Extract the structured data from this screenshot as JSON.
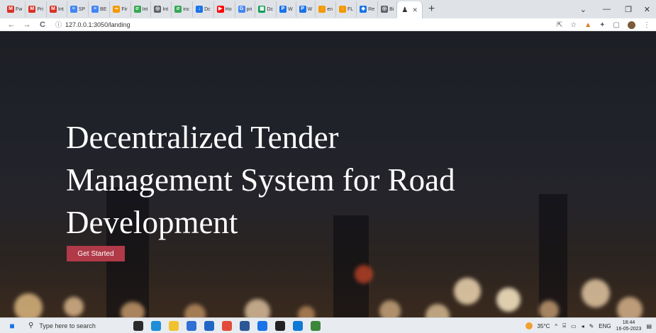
{
  "browser": {
    "tabs": [
      {
        "label": "Fw",
        "icon": "gmail-icon",
        "color": "#d93025"
      },
      {
        "label": "Pri",
        "icon": "gmail-icon",
        "color": "#d93025"
      },
      {
        "label": "Int",
        "icon": "gmail-icon",
        "color": "#d93025"
      },
      {
        "label": "SP",
        "icon": "doc-icon",
        "color": "#4285f4"
      },
      {
        "label": "BE",
        "icon": "doc-icon",
        "color": "#4285f4"
      },
      {
        "label": "Fir",
        "icon": "infinity-icon",
        "color": "#f29900"
      },
      {
        "label": "Int",
        "icon": "leaf-icon",
        "color": "#34a853"
      },
      {
        "label": "Int",
        "icon": "globe-icon",
        "color": "#5f6368"
      },
      {
        "label": "inc",
        "icon": "leaf-icon",
        "color": "#34a853"
      },
      {
        "label": "Dc",
        "icon": "download-icon",
        "color": "#1a73e8"
      },
      {
        "label": "Ho",
        "icon": "youtube-icon",
        "color": "#ff0000"
      },
      {
        "label": "pri",
        "icon": "google-icon",
        "color": "#4285f4"
      },
      {
        "label": "Dc",
        "icon": "sheet-icon",
        "color": "#0f9d58"
      },
      {
        "label": "W",
        "icon": "pen-icon",
        "color": "#1a73e8"
      },
      {
        "label": "W",
        "icon": "pen-icon",
        "color": "#1a73e8"
      },
      {
        "label": "en",
        "icon": "orbit-icon",
        "color": "#f29900"
      },
      {
        "label": "FL",
        "icon": "orbit-icon",
        "color": "#f29900"
      },
      {
        "label": "Re",
        "icon": "diamond-icon",
        "color": "#1a73e8"
      },
      {
        "label": "Bi",
        "icon": "globe-icon",
        "color": "#5f6368"
      }
    ],
    "active_tab": {
      "label": "",
      "icon": "people-icon"
    },
    "new_tab": "+",
    "address": {
      "url": "127.0.0.1:3050/landing",
      "back": "←",
      "forward": "→",
      "reload": "C",
      "info": "ⓘ"
    },
    "window": {
      "chevron": "⌄",
      "minimize": "—",
      "restore": "❐",
      "close": "✕"
    }
  },
  "hero": {
    "title": "Decentralized Tender Management System for Road Development",
    "cta_label": "Get Started",
    "accent": "#b03a48"
  },
  "taskbar": {
    "search_placeholder": "Type here to search",
    "temperature": "35°C",
    "language": "ENG",
    "time": "18:44",
    "date": "16-05-2023",
    "apps": [
      {
        "name": "task-view-icon",
        "color": "#2b2b2b"
      },
      {
        "name": "edge-icon",
        "color": "#1e8fd6"
      },
      {
        "name": "file-explorer-icon",
        "color": "#f2c12e"
      },
      {
        "name": "store-icon",
        "color": "#2f6fd6"
      },
      {
        "name": "mail-icon",
        "color": "#2266c5"
      },
      {
        "name": "chrome-icon",
        "color": "#e24a3b"
      },
      {
        "name": "word-icon",
        "color": "#2b5797"
      },
      {
        "name": "vlc-icon",
        "color": "#1a73e8"
      },
      {
        "name": "terminal-icon",
        "color": "#222222"
      },
      {
        "name": "vscode-icon",
        "color": "#0e7ad6"
      },
      {
        "name": "node-icon",
        "color": "#3c873a"
      }
    ]
  }
}
